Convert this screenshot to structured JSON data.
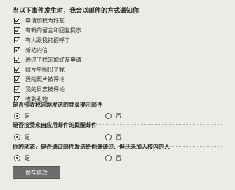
{
  "heading": "当以下事件发生时，我会以邮件的方式通知你",
  "notify_options": [
    {
      "label": "申请加我为好友",
      "checked": true
    },
    {
      "label": "有新的留言和回复提示",
      "checked": true
    },
    {
      "label": "有人跟我打招呼了",
      "checked": true
    },
    {
      "label": "新站内信",
      "checked": true
    },
    {
      "label": "通过了我的加好友申请",
      "checked": true
    },
    {
      "label": "照片中圈出了我",
      "checked": true
    },
    {
      "label": "我的照片被评论",
      "checked": true
    },
    {
      "label": "我的日志被评论",
      "checked": true
    },
    {
      "label": "收到礼物",
      "checked": true
    }
  ],
  "q1": {
    "label": "是否接收我向网发送的登录提示邮件",
    "yes": "是",
    "no": "否",
    "selected": "yes"
  },
  "q2": {
    "label": "是否接受来自应用邮件的提醒邮件",
    "yes": "是",
    "no": "否",
    "selected": "yes"
  },
  "q3": {
    "label": "你的动态，是否通过邮件发送给你邀请过、但还未加入校内的人",
    "yes": "是",
    "no": "否",
    "selected": "yes"
  },
  "save_label": "保存修改"
}
